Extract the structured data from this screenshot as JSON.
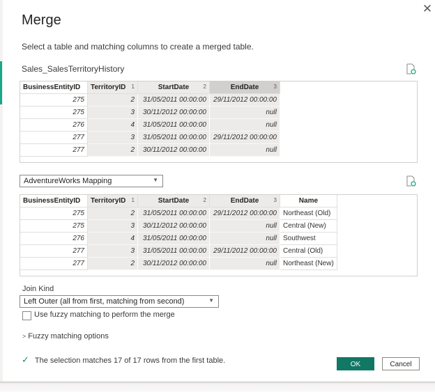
{
  "dialog": {
    "title": "Merge",
    "subtitle": "Select a table and matching columns to create a merged table.",
    "close_icon": "close-icon"
  },
  "first_table": {
    "name": "Sales_SalesTerritoryHistory",
    "refresh_icon": "refresh-preview-icon",
    "columns": [
      {
        "label": "BusinessEntityID",
        "index": ""
      },
      {
        "label": "TerritoryID",
        "index": "1"
      },
      {
        "label": "StartDate",
        "index": "2"
      },
      {
        "label": "EndDate",
        "index": "3"
      }
    ],
    "rows": [
      [
        "275",
        "2",
        "31/05/2011 00:00:00",
        "29/11/2012 00:00:00"
      ],
      [
        "275",
        "3",
        "30/11/2012 00:00:00",
        "null"
      ],
      [
        "276",
        "4",
        "31/05/2011 00:00:00",
        "null"
      ],
      [
        "277",
        "3",
        "31/05/2011 00:00:00",
        "29/11/2012 00:00:00"
      ],
      [
        "277",
        "2",
        "30/11/2012 00:00:00",
        "null"
      ]
    ]
  },
  "second_table": {
    "selected": "AdventureWorks Mapping",
    "refresh_icon": "refresh-preview-icon",
    "columns": [
      {
        "label": "BusinessEntityID",
        "index": ""
      },
      {
        "label": "TerritoryID",
        "index": "1"
      },
      {
        "label": "StartDate",
        "index": "2"
      },
      {
        "label": "EndDate",
        "index": "3"
      },
      {
        "label": "Name",
        "index": ""
      }
    ],
    "rows": [
      [
        "275",
        "2",
        "31/05/2011 00:00:00",
        "29/11/2012 00:00:00",
        "Northeast (Old)"
      ],
      [
        "275",
        "3",
        "30/11/2012 00:00:00",
        "null",
        "Central (New)"
      ],
      [
        "276",
        "4",
        "31/05/2011 00:00:00",
        "null",
        "Southwest"
      ],
      [
        "277",
        "3",
        "31/05/2011 00:00:00",
        "29/11/2012 00:00:00",
        "Central (Old)"
      ],
      [
        "277",
        "2",
        "30/11/2012 00:00:00",
        "null",
        "Northeast (New)"
      ]
    ]
  },
  "join": {
    "label": "Join Kind",
    "selected": "Left Outer (all from first, matching from second)"
  },
  "fuzzy": {
    "checkbox_label": "Use fuzzy matching to perform the merge",
    "checked": false,
    "options_label": "Fuzzy matching options"
  },
  "status": {
    "icon": "checkmark-icon",
    "text": "The selection matches 17 of 17 rows from the first table."
  },
  "buttons": {
    "ok": "OK",
    "cancel": "Cancel"
  },
  "colors": {
    "primary": "#117865",
    "success": "#208a6a",
    "key_column": "#edebe9"
  }
}
